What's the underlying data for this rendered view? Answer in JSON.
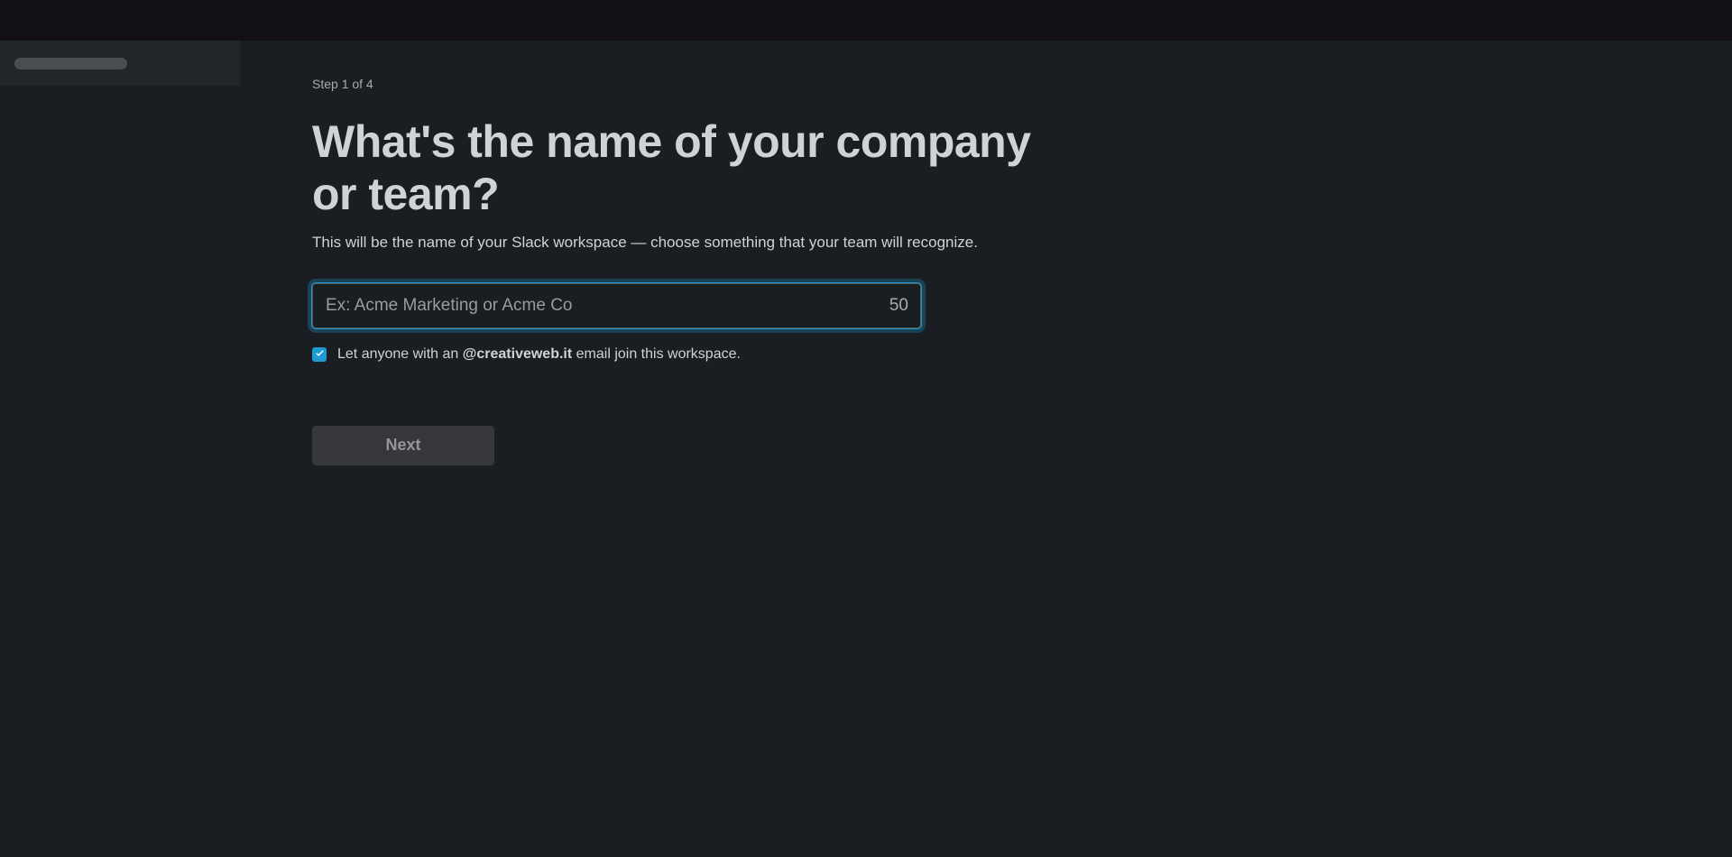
{
  "step": "Step 1 of 4",
  "heading": "What's the name of your company or team?",
  "subheading": "This will be the name of your Slack workspace — choose something that your team will recognize.",
  "input": {
    "placeholder": "Ex: Acme Marketing or Acme Co",
    "counter": "50"
  },
  "checkbox": {
    "prefix": "Let anyone with an ",
    "domain": "@creativeweb.it",
    "suffix": " email join this workspace."
  },
  "nextButton": "Next"
}
